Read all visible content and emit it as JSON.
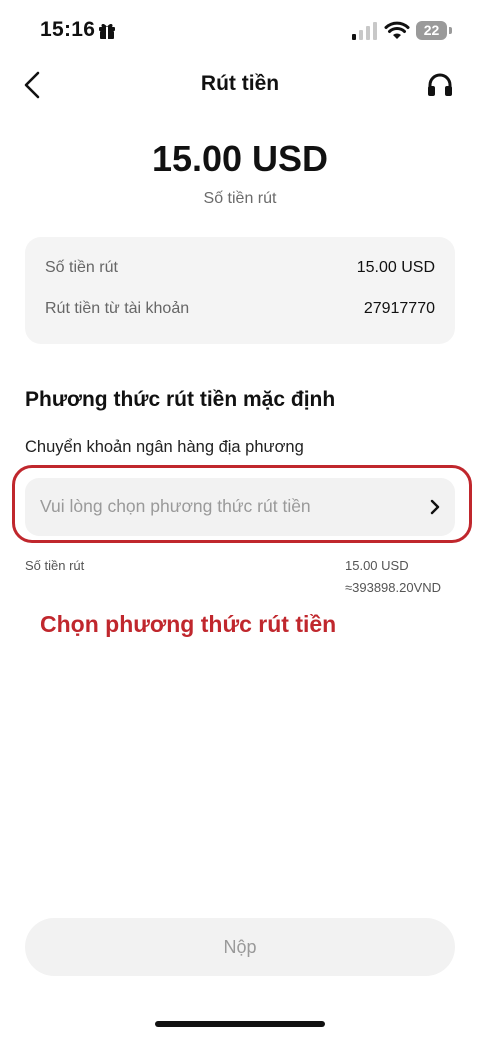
{
  "status_bar": {
    "time": "15:16",
    "battery_level": "22",
    "icons": [
      "gift-icon",
      "cellular-signal-icon",
      "wifi-icon",
      "battery-icon"
    ]
  },
  "header": {
    "title": "Rút tiền",
    "back_icon": "chevron-left-icon",
    "support_icon": "headset-icon"
  },
  "amount": {
    "value": "15.00 USD",
    "caption": "Số tiền rút"
  },
  "details": {
    "rows": [
      {
        "label": "Số tiền rút",
        "value": "15.00 USD"
      },
      {
        "label": "Rút tiền từ tài khoản",
        "value": "27917770"
      }
    ]
  },
  "method": {
    "section_title": "Phương thức rút tiền mặc định",
    "subtitle": "Chuyển khoản ngân hàng địa phương",
    "placeholder": "Vui lòng chọn phương thức rút tiền",
    "chevron_icon": "chevron-right-icon"
  },
  "summary": {
    "label": "Số tiền rút",
    "usd": "15.00 USD",
    "vnd": "≈393898.20VND"
  },
  "annotation": {
    "text": "Chọn phương thức rút tiền",
    "color": "#c0272d"
  },
  "submit": {
    "label": "Nộp"
  }
}
